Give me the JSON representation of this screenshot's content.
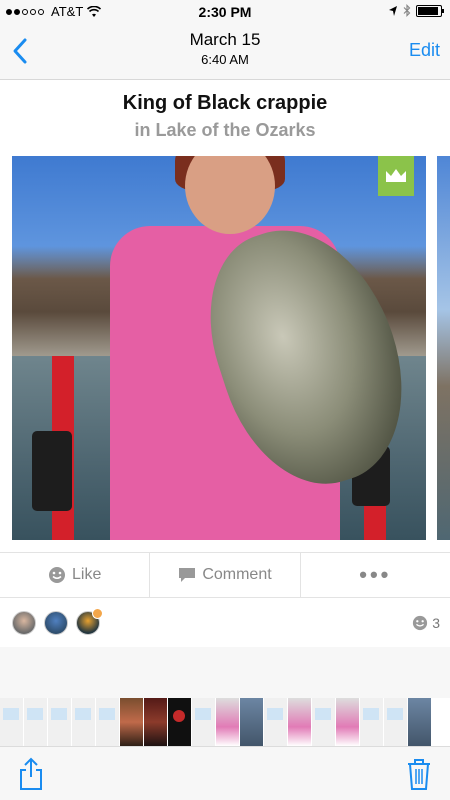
{
  "status_bar": {
    "carrier": "AT&T",
    "time": "2:30 PM",
    "signal_bars_filled": 2,
    "signal_bars_total": 5,
    "battery_level": 0.9
  },
  "nav": {
    "date": "March 15",
    "time": "6:40 AM",
    "edit_label": "Edit",
    "back_icon": "chevron-left-icon",
    "accent_color": "#1a8cf0"
  },
  "post": {
    "title": "King of Black crappie",
    "subtitle": "in Lake of the Ozarks",
    "badge_icon": "crown-icon",
    "badge_color": "#8bc34a"
  },
  "actions": {
    "like_label": "Like",
    "comment_label": "Comment",
    "more_label": "•••"
  },
  "reactions": {
    "count": "3"
  },
  "toolbar": {
    "share_icon": "share-icon",
    "trash_icon": "trash-icon"
  }
}
